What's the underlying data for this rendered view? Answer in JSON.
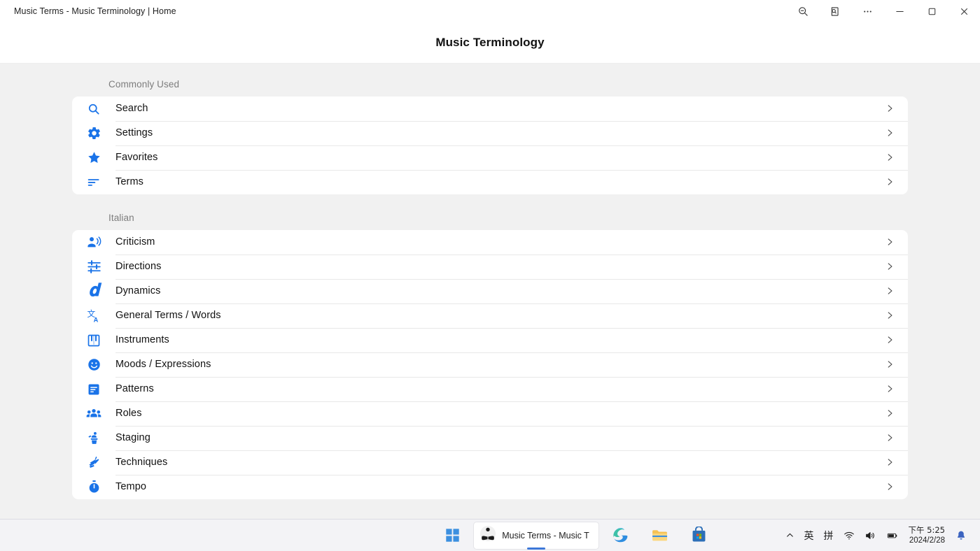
{
  "window": {
    "title": "Music Terms - Music Terminology | Home",
    "controls": [
      {
        "name": "zoom-out-icon",
        "label": "Zoom out"
      },
      {
        "name": "search-page-icon",
        "label": "Search this page"
      },
      {
        "name": "more-options-icon",
        "label": "More"
      },
      {
        "name": "minimize-icon",
        "label": "Minimize"
      },
      {
        "name": "maximize-icon",
        "label": "Maximize"
      },
      {
        "name": "close-icon",
        "label": "Close"
      }
    ]
  },
  "header": {
    "title": "Music Terminology"
  },
  "sections": [
    {
      "label": "Commonly Used",
      "items": [
        {
          "label": "Search",
          "icon": "search-icon"
        },
        {
          "label": "Settings",
          "icon": "settings-gear-icon"
        },
        {
          "label": "Favorites",
          "icon": "star-icon"
        },
        {
          "label": "Terms",
          "icon": "subject-lines-icon"
        }
      ]
    },
    {
      "label": "Italian",
      "items": [
        {
          "label": "Criticism",
          "icon": "record-voice-over-icon"
        },
        {
          "label": "Directions",
          "icon": "tune-sliders-icon"
        },
        {
          "label": "Dynamics",
          "icon": "forte-icon"
        },
        {
          "label": "General Terms / Words",
          "icon": "translate-icon"
        },
        {
          "label": "Instruments",
          "icon": "piano-keys-icon"
        },
        {
          "label": "Moods / Expressions",
          "icon": "smiley-face-icon"
        },
        {
          "label": "Patterns",
          "icon": "notes-document-icon"
        },
        {
          "label": "Roles",
          "icon": "people-group-icon"
        },
        {
          "label": "Staging",
          "icon": "podium-icon"
        },
        {
          "label": "Techniques",
          "icon": "sign-language-hand-icon"
        },
        {
          "label": "Tempo",
          "icon": "stopwatch-icon"
        }
      ]
    }
  ],
  "taskbar": {
    "start_label": "Start",
    "apps": [
      {
        "name": "music-terms-app",
        "label": "Music Terms - Music T",
        "active": true
      },
      {
        "name": "edge-browser",
        "label": "Microsoft Edge",
        "active": false
      },
      {
        "name": "file-explorer",
        "label": "File Explorer",
        "active": false
      },
      {
        "name": "microsoft-store",
        "label": "Microsoft Store",
        "active": false
      }
    ],
    "tray": {
      "overflow": "⌃",
      "ime_language": "英",
      "ime_mode": "拼",
      "time": "下午 5:25",
      "date": "2024/2/28"
    }
  },
  "colors": {
    "accent_blue": "#1a73e8",
    "page_bg": "#f1f1f1",
    "card_bg": "#ffffff",
    "text": "#111111",
    "muted_text": "#7d7d7d",
    "taskbar_bg": "#f3f3f6"
  }
}
